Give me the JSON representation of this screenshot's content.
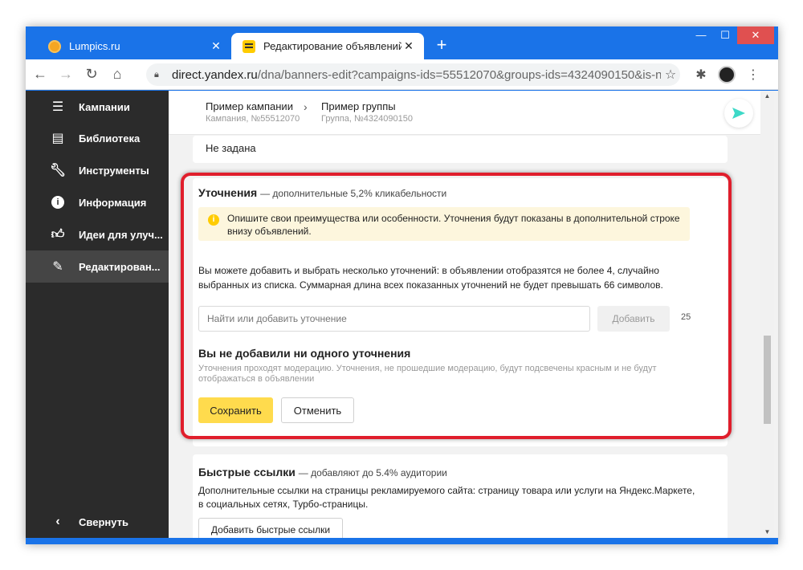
{
  "browser": {
    "tabs": [
      {
        "title": "Lumpics.ru",
        "favicon": "lumpics-favicon"
      },
      {
        "title": "Редактирование объявлений",
        "favicon": "yandex-direct-favicon"
      }
    ],
    "url_host": "direct.yandex.ru",
    "url_path": "/dna/banners-edit?campaigns-ids=55512070&groups-ids=4324090150&is-ne..."
  },
  "sidebar": {
    "items": [
      {
        "label": "Кампании",
        "icon": "list-icon"
      },
      {
        "label": "Библиотека",
        "icon": "library-icon"
      },
      {
        "label": "Инструменты",
        "icon": "wrench-icon"
      },
      {
        "label": "Информация",
        "icon": "info-icon"
      },
      {
        "label": "Идеи для улуч...",
        "icon": "thumbs-up-icon"
      },
      {
        "label": "Редактирован...",
        "icon": "pencil-icon"
      }
    ],
    "collapse_label": "Свернуть"
  },
  "breadcrumb": {
    "campaign_name": "Пример кампании",
    "campaign_id": "Кампания, №55512070",
    "group_name": "Пример группы",
    "group_id": "Группа, №4324090150"
  },
  "prev_card": {
    "text": "Не задана"
  },
  "refinements": {
    "title": "Уточнения",
    "subtitle": "— дополнительные 5,2% кликабельности",
    "info": "Опишите свои преимущества или особенности. Уточнения будут показаны в дополнительной строке внизу объявлений.",
    "description": "Вы можете добавить и выбрать несколько уточнений: в объявлении отобразятся не более 4, случайно выбранных из списка. Суммарная длина всех показанных уточнений не будет превышать 66 символов.",
    "search_placeholder": "Найти или добавить уточнение",
    "add_label": "Добавить",
    "counter": "25",
    "empty_title": "Вы не добавили ни одного уточнения",
    "empty_desc": "Уточнения проходят модерацию. Уточнения, не прошедшие модерацию, будут подсвечены красным и не будут отображаться в объявлении",
    "save_label": "Сохранить",
    "cancel_label": "Отменить"
  },
  "quick_links": {
    "title": "Быстрые ссылки",
    "subtitle": "— добавляют до 5.4% аудитории",
    "description": "Дополнительные ссылки на страницы рекламируемого сайта: страницу товара или услуги на Яндекс.Маркете, в социальных сетях, Турбо-страницы.",
    "add_label": "Добавить быстрые ссылки"
  },
  "colors": {
    "highlight": "#e01e2c",
    "primary_button": "#ffdb4d",
    "sidebar_bg": "#2b2b2b",
    "browser_chrome": "#1a73e8"
  }
}
